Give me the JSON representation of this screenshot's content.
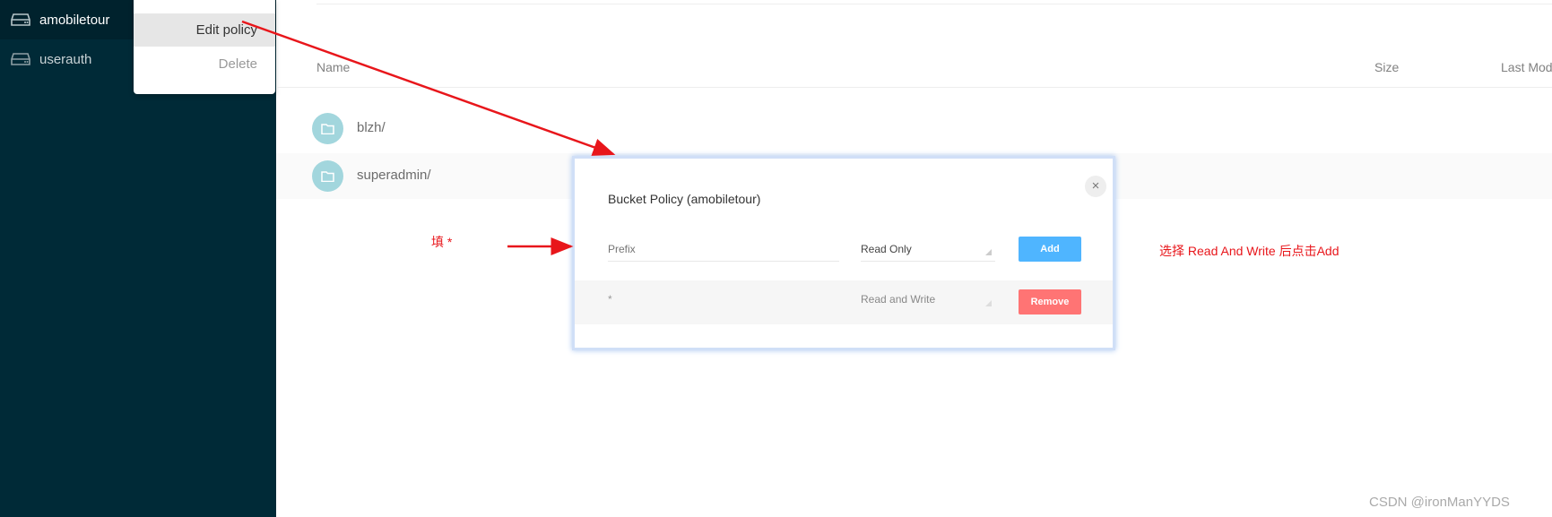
{
  "sidebar": {
    "items": [
      {
        "label": "amobiletour",
        "icon": "drive-icon"
      },
      {
        "label": "userauth",
        "icon": "drive-icon"
      }
    ]
  },
  "context_menu": {
    "items": [
      "Edit policy",
      "Delete"
    ]
  },
  "table": {
    "headers": [
      "Name",
      "Size",
      "Last Mod"
    ],
    "rows": [
      {
        "name": "blzh/",
        "icon": "folder-icon"
      },
      {
        "name": "superadmin/",
        "icon": "folder-icon"
      }
    ]
  },
  "dialog": {
    "title": "Bucket Policy (amobiletour)",
    "prefix_placeholder": "Prefix",
    "policy_select": "Read Only",
    "add_label": "Add",
    "policies": [
      {
        "prefix": "*",
        "policy": "Read and Write",
        "remove_label": "Remove"
      }
    ]
  },
  "annotations": {
    "fill_note": "填 *",
    "select_note": "选择 Read And Write 后点击Add",
    "watermark": "CSDN @ironManYYDS"
  },
  "colors": {
    "sidebar": "#002a37",
    "add": "#4fb5ff",
    "remove": "#ff7474",
    "annotation": "#e8161b",
    "folder": "#a2d6dd"
  }
}
